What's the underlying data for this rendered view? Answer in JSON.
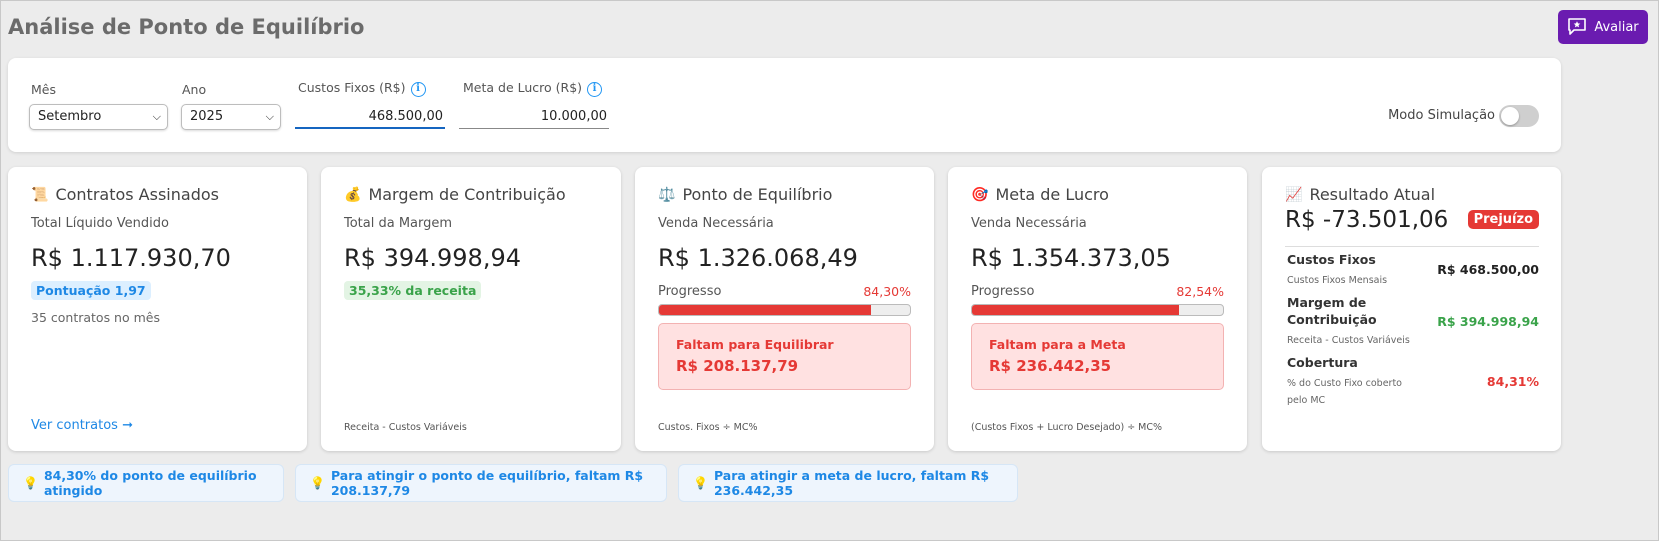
{
  "header": {
    "title": "Análise de Ponto de Equilíbrio",
    "avaliar_label": "Avaliar"
  },
  "filters": {
    "mes_label": "Mês",
    "mes_value": "Setembro",
    "ano_label": "Ano",
    "ano_value": "2025",
    "custos_label": "Custos Fixos (R$)",
    "custos_value": "468.500,00",
    "meta_label": "Meta de Lucro (R$)",
    "meta_value": "10.000,00",
    "modo_label": "Modo Simulação",
    "modo_on": false
  },
  "cards": {
    "contratos": {
      "title": "Contratos Assinados",
      "subtitle": "Total Líquido Vendido",
      "value": "R$ 1.117.930,70",
      "badge": "Pontuação 1,97",
      "note": "35 contratos no mês",
      "link": "Ver contratos ➞"
    },
    "margem": {
      "title": "Margem de Contribuição",
      "subtitle": "Total da Margem",
      "value": "R$ 394.998,94",
      "badge": "35,33% da receita",
      "footer": "Receita - Custos Variáveis"
    },
    "ponto": {
      "title": "Ponto de Equilíbrio",
      "subtitle": "Venda Necessária",
      "value": "R$ 1.326.068,49",
      "progress_label": "Progresso",
      "progress_pct": "84,30%",
      "progress_value": 84.3,
      "alert_title": "Faltam para Equilibrar",
      "alert_value": "R$ 208.137,79",
      "footer": "Custos. Fixos ÷ MC%"
    },
    "meta": {
      "title": "Meta de Lucro",
      "subtitle": "Venda Necessária",
      "value": "R$ 1.354.373,05",
      "progress_label": "Progresso",
      "progress_pct": "82,54%",
      "progress_value": 82.54,
      "alert_title": "Faltam para a Meta",
      "alert_value": "R$ 236.442,35",
      "footer": "(Custos Fixos + Lucro Desejado) ÷ MC%"
    },
    "resultado": {
      "title": "Resultado Atual",
      "value": "R$ -73.501,06",
      "badge": "Prejuízo",
      "rows": [
        {
          "title": "Custos Fixos",
          "sub": "Custos Fixos Mensais",
          "value": "R$ 468.500,00"
        },
        {
          "title": "Margem de",
          "title2": "Contribuição",
          "sub": "Receita - Custos Variáveis",
          "value": "R$ 394.998,94"
        },
        {
          "title": "Cobertura",
          "sub": "% do Custo Fixo coberto",
          "sub2": "pelo MC",
          "value": "84,31%"
        }
      ]
    }
  },
  "tips": [
    "84,30% do ponto de equilíbrio atingido",
    "Para atingir o ponto de equilíbrio, faltam R$ 208.137,79",
    "Para atingir a meta de lucro, faltam R$ 236.442,35"
  ],
  "colors": {
    "accent": "#6a1bb0",
    "danger": "#e53935",
    "success": "#3aa34a",
    "info": "#1e88e5"
  }
}
